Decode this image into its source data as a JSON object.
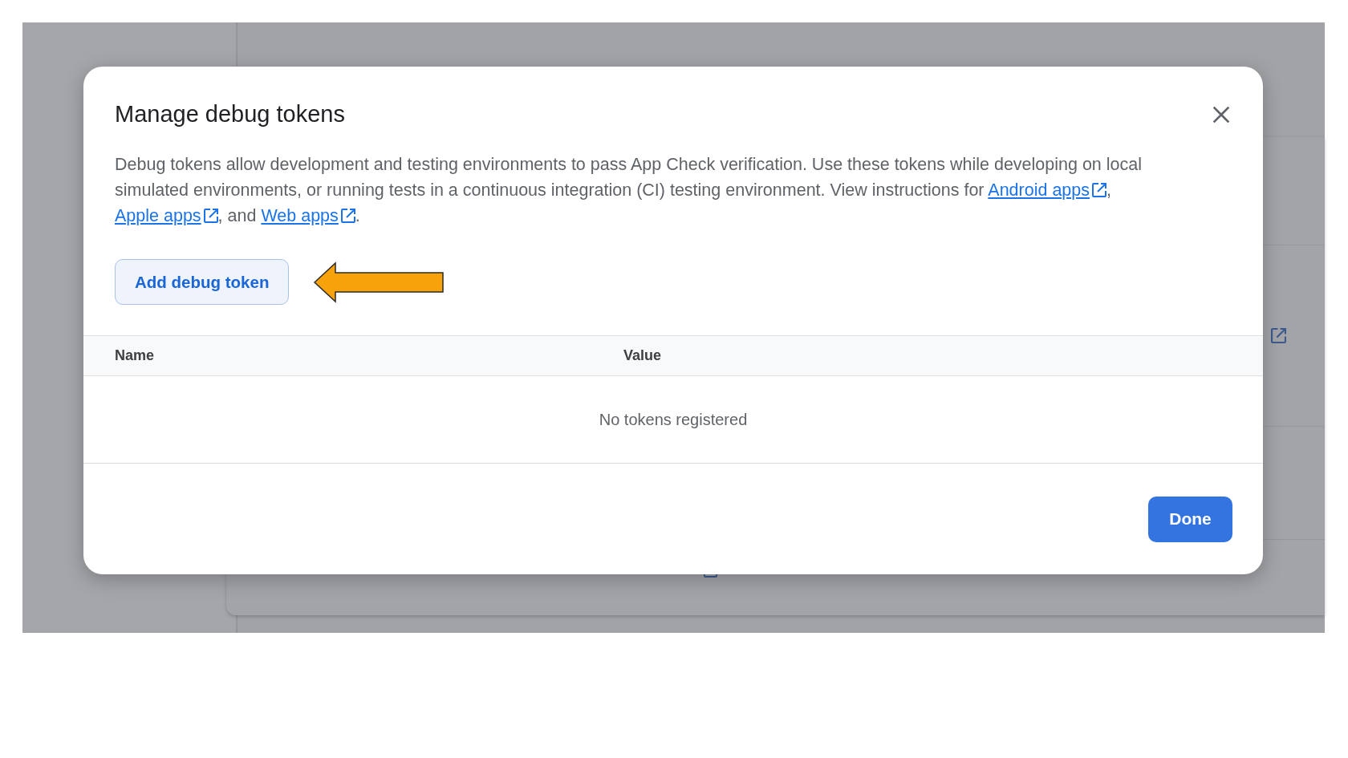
{
  "dialog": {
    "title": "Manage debug tokens",
    "description": [
      {
        "kind": "text",
        "text": "Debug tokens allow development and testing environments to pass App Check verification. Use these tokens while developing on local simulated environments, or running tests in a continuous integration (CI) testing environment. View instructions for "
      },
      {
        "kind": "link",
        "text": "Android apps"
      },
      {
        "kind": "text",
        "text": ", "
      },
      {
        "kind": "link",
        "text": "Apple apps"
      },
      {
        "kind": "text",
        "text": ", and "
      },
      {
        "kind": "link",
        "text": "Web apps"
      },
      {
        "kind": "text",
        "text": "."
      }
    ],
    "add_button": "Add debug token",
    "table": {
      "columns": [
        "Name",
        "Value"
      ],
      "empty_message": "No tokens registered"
    },
    "buttons": [
      "Done"
    ]
  }
}
